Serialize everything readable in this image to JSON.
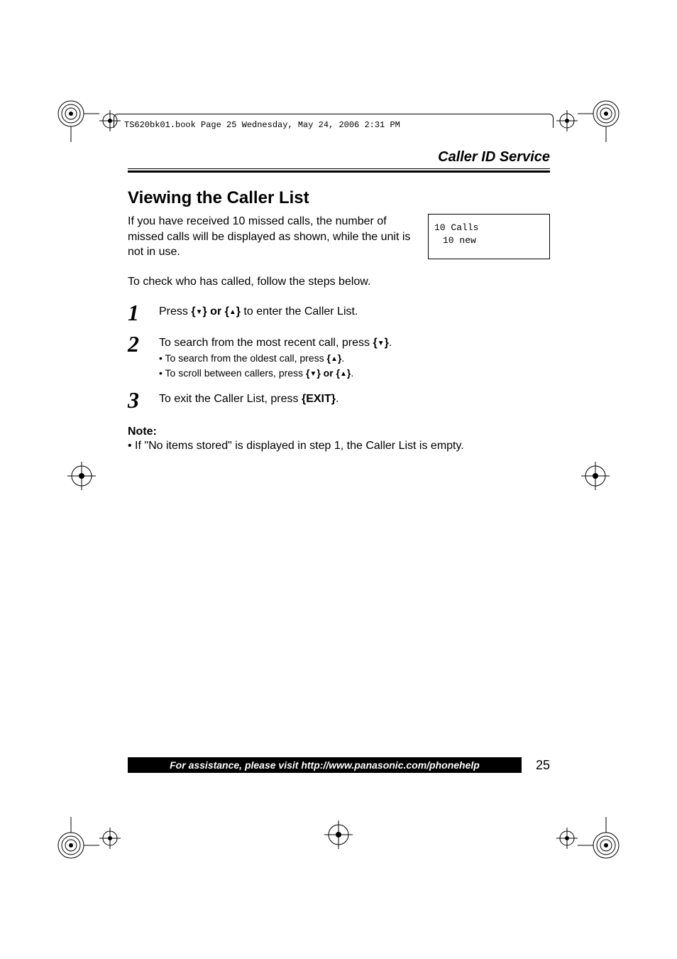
{
  "header_line": "TS620bk01.book  Page 25  Wednesday, May 24, 2006  2:31 PM",
  "section_label": "Caller ID Service",
  "heading": "Viewing the Caller List",
  "intro": "If you have received 10 missed calls, the number of missed calls will be displayed as shown, while the unit is not in use.",
  "display_line1": "10 Calls",
  "display_line2": "10 new",
  "check_line": "To check who has called, follow the steps below.",
  "steps": [
    {
      "num": "1",
      "main_pre": "Press ",
      "main_keys": "{▼} or {▲}",
      "main_post": " to enter the Caller List."
    },
    {
      "num": "2",
      "main_pre": "To search from the most recent call, press ",
      "main_keys": "{▼}",
      "main_post": ".",
      "subs": [
        {
          "pre": "• To search from the oldest call, press ",
          "keys": "{▲}",
          "post": "."
        },
        {
          "pre": "• To scroll between callers, press ",
          "keys": "{▼} or {▲}",
          "post": "."
        }
      ]
    },
    {
      "num": "3",
      "main_pre": "To exit the Caller List, press ",
      "main_keys": "{EXIT}",
      "main_post": "."
    }
  ],
  "note_label": "Note:",
  "note_item": "• If \"No items stored\" is displayed in step 1, the Caller List is empty.",
  "footer_text": "For assistance, please visit http://www.panasonic.com/phonehelp",
  "page_number": "25"
}
